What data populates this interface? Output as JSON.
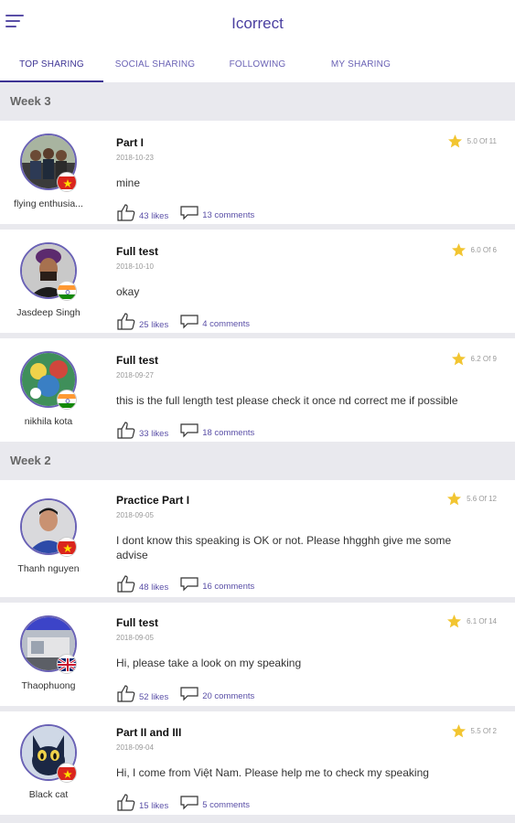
{
  "app": {
    "title": "Icorrect"
  },
  "tabs": [
    {
      "label": "TOP SHARING",
      "active": true
    },
    {
      "label": "SOCIAL SHARING",
      "active": false
    },
    {
      "label": "FOLLOWING",
      "active": false
    },
    {
      "label": "MY SHARING",
      "active": false
    }
  ],
  "weeks": [
    {
      "label": "Week 3"
    },
    {
      "label": "Week 2"
    }
  ],
  "posts": [
    {
      "user": "flying enthusia...",
      "flag": "vietnam",
      "title": "Part I",
      "date": "2018-10-23",
      "text": "mine",
      "rating": "5.0 Of 11",
      "likes": "43 likes",
      "comments": "13 comments",
      "avatar": "group-photo"
    },
    {
      "user": "Jasdeep Singh",
      "flag": "india",
      "title": "Full test",
      "date": "2018-10-10",
      "text": "okay",
      "rating": "6.0 Of 6",
      "likes": "25 likes",
      "comments": "4 comments",
      "avatar": "turban-portrait"
    },
    {
      "user": "nikhila kota",
      "flag": "india",
      "title": "Full test",
      "date": "2018-09-27",
      "text": "this is the full length test please check it once nd correct me if possible",
      "rating": "6.2 Of 9",
      "likes": "33 likes",
      "comments": "18 comments",
      "avatar": "colorful-portrait"
    },
    {
      "user": "Thanh nguyen",
      "flag": "vietnam",
      "title": "Practice Part I",
      "date": "2018-09-05",
      "text": "I dont know this speaking is OK or not. Please hhgghh give me some advise",
      "rating": "5.6 Of 12",
      "likes": "48 likes",
      "comments": "16 comments",
      "avatar": "man-portrait"
    },
    {
      "user": "Thaophuong",
      "flag": "uk",
      "title": "Full test",
      "date": "2018-09-05",
      "text": "Hi, please take a look on my speaking",
      "rating": "6.1 Of 14",
      "likes": "52 likes",
      "comments": "20 comments",
      "avatar": "room-photo"
    },
    {
      "user": "Black cat",
      "flag": "vietnam",
      "title": "Part II and III",
      "date": "2018-09-04",
      "text": "Hi, I come from Việt Nam. Please help me to check my speaking",
      "rating": "5.5 Of 2",
      "likes": "15 likes",
      "comments": "5 comments",
      "avatar": "cat-cartoon"
    }
  ],
  "icons": {
    "star": "star-icon",
    "like": "thumbs-up-icon",
    "comment": "comment-icon",
    "menu": "hamburger-menu-icon"
  },
  "colors": {
    "accent": "#3d3394",
    "star": "#f2c531",
    "link": "#5a4fa7"
  }
}
